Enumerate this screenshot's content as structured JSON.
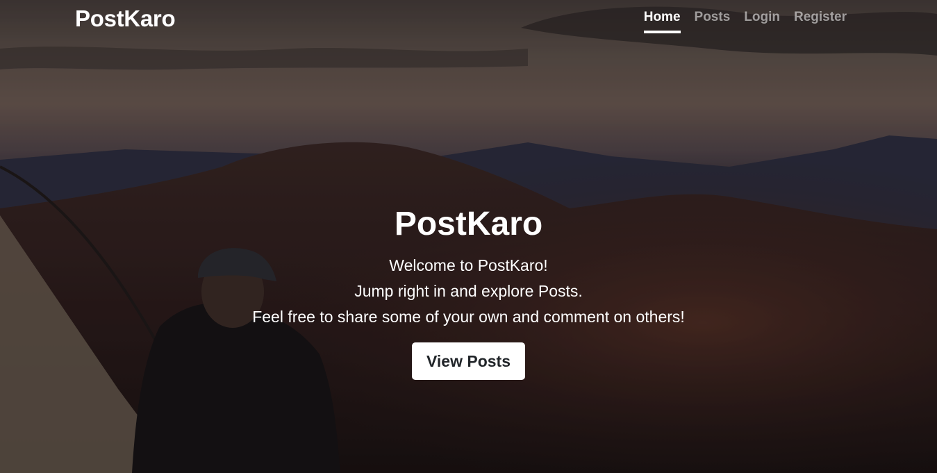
{
  "nav": {
    "brand": "PostKaro",
    "links": [
      {
        "label": "Home",
        "active": true
      },
      {
        "label": "Posts",
        "active": false
      },
      {
        "label": "Login",
        "active": false
      },
      {
        "label": "Register",
        "active": false
      }
    ]
  },
  "cover": {
    "title": "PostKaro",
    "lines": [
      "Welcome to PostKaro!",
      "Jump right in and explore Posts.",
      "Feel free to share some of your own and comment on others!"
    ],
    "button_label": "View Posts"
  },
  "colors": {
    "text": "#ffffff",
    "muted_link": "rgba(255,255,255,0.55)",
    "button_bg": "#ffffff",
    "button_text": "#212529"
  }
}
